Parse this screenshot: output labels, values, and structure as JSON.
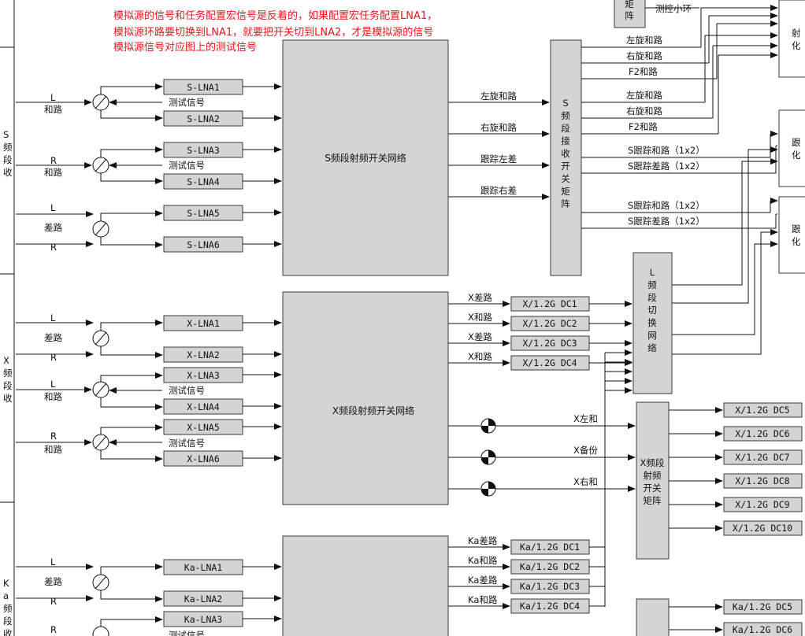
{
  "notes": [
    "模拟源的信号和任务配置宏信号是反着的，如果配置宏任务配置LNA1，",
    "模拟源环路要切换到LNA1，就要把开关切到LNA2，才是模拟源的信号",
    "模拟源信号对应图上的测试信号"
  ],
  "sections": [
    {
      "id": "s",
      "chars": [
        "S",
        "频",
        "段",
        "收"
      ]
    },
    {
      "id": "x",
      "chars": [
        "X",
        "频",
        "段",
        "收"
      ]
    },
    {
      "id": "ka",
      "chars": [
        "K",
        "a",
        "频",
        "段",
        "收"
      ]
    }
  ],
  "input_labels": {
    "L": "L",
    "R": "R",
    "he": "和路",
    "cha": "差路",
    "test": "测试信号"
  },
  "lna": {
    "s": [
      "S-LNA1",
      "S-LNA2",
      "S-LNA3",
      "S-LNA4",
      "S-LNA5",
      "S-LNA6"
    ],
    "x": [
      "X-LNA1",
      "X-LNA2",
      "X-LNA3",
      "X-LNA4",
      "X-LNA5",
      "X-LNA6"
    ],
    "ka": [
      "Ka-LNA1",
      "Ka-LNA2",
      "Ka-LNA3"
    ]
  },
  "networks": {
    "s": "S频段射频开关网络",
    "x": "X频段射频开关网络"
  },
  "s_net_outputs": [
    "左旋和路",
    "右旋和路",
    "跟踪左差",
    "跟踪右差"
  ],
  "s_matrix": [
    "S",
    "频",
    "段",
    "接",
    "收",
    "开",
    "关",
    "矩",
    "阵"
  ],
  "s_matrix_outputs": [
    "左旋和路",
    "右旋和路",
    "F2和路",
    "左旋和路",
    "右旋和路",
    "F2和路",
    "S跟踪和路（1x2）",
    "S跟踪差路（1x2）",
    "S跟踪和路（1x2）",
    "S跟踪差路（1x2）"
  ],
  "top_partial": {
    "matrix_tail": [
      "矩",
      "阵"
    ],
    "loop": "测控小环"
  },
  "right_partial": {
    "shepin": [
      "射",
      "化"
    ],
    "track1": [
      "跟",
      "化"
    ],
    "track2": [
      "跟",
      "化"
    ]
  },
  "x_outputs": [
    "X差路",
    "X和路",
    "X差路",
    "X和路"
  ],
  "x_dc": [
    "X/1.2G DC1",
    "X/1.2G DC2",
    "X/1.2G DC3",
    "X/1.2G DC4"
  ],
  "l_switch": [
    "L",
    "频",
    "段",
    "切",
    "换",
    "网",
    "络"
  ],
  "x_switch_outputs": [
    "X左和",
    "X备份",
    "X右和"
  ],
  "x_switch_matrix": [
    "X频段",
    "射频",
    "开关",
    "矩阵"
  ],
  "x_dc_right": [
    "X/1.2G DC5",
    "X/1.2G DC6",
    "X/1.2G DC7",
    "X/1.2G DC8",
    "X/1.2G DC9",
    "X/1.2G DC10"
  ],
  "ka_outputs": [
    "Ka差路",
    "Ka和路",
    "Ka差路",
    "Ka和路"
  ],
  "ka_dc": [
    "Ka/1.2G DC1",
    "Ka/1.2G DC2",
    "Ka/1.2G DC3",
    "Ka/1.2G DC4"
  ],
  "ka_dc_right": [
    "Ka/1.2G DC5",
    "Ka/1.2G DC6"
  ]
}
